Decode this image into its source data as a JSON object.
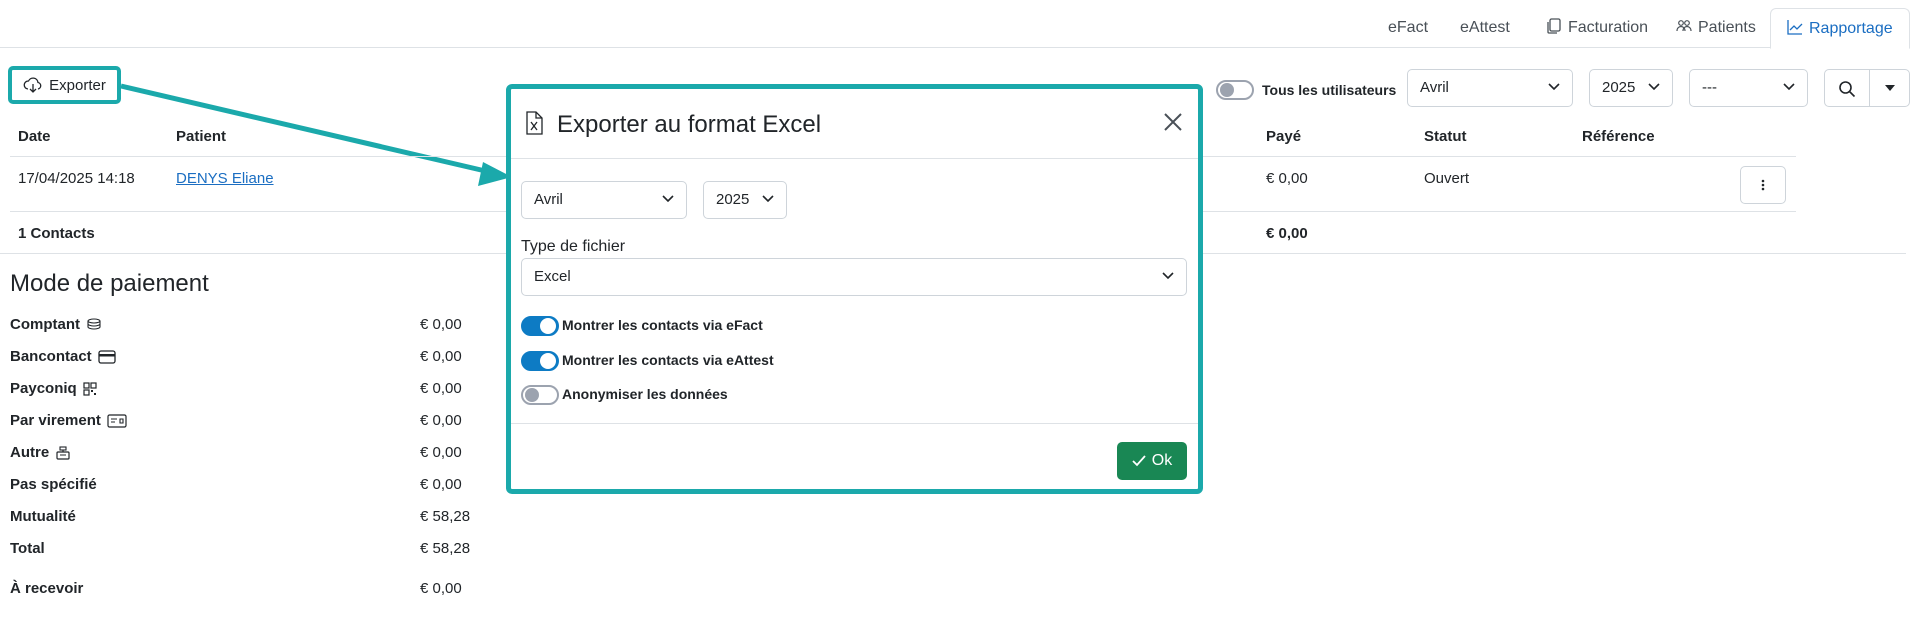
{
  "tabs": [
    {
      "label": "eFact",
      "icon": ""
    },
    {
      "label": "eAttest",
      "icon": ""
    },
    {
      "label": "Facturation",
      "icon": "files-icon"
    },
    {
      "label": "Patients",
      "icon": "people-icon"
    },
    {
      "label": "Rapportage",
      "icon": "graph-up-icon"
    }
  ],
  "toolbar": {
    "export_label": "Exporter",
    "all_users_label": "Tous les utilisateurs",
    "month_value": "Avril",
    "year_value": "2025",
    "extra_value": "---"
  },
  "table": {
    "headers": {
      "date": "Date",
      "patient": "Patient",
      "paid": "Payé",
      "status": "Statut",
      "reference": "Référence"
    },
    "rows": [
      {
        "date": "17/04/2025 14:18",
        "patient": "DENYS Eliane",
        "paid": "€ 0,00",
        "status": "Ouvert",
        "reference": ""
      }
    ],
    "footer": {
      "count": "1 Contacts",
      "paid_total": "€ 0,00"
    }
  },
  "payment": {
    "title": "Mode de paiement",
    "items": [
      {
        "label": "Comptant",
        "value": "€ 0,00",
        "icon": "cash-stack-icon"
      },
      {
        "label": "Bancontact",
        "value": "€ 0,00",
        "icon": "credit-card-icon"
      },
      {
        "label": "Payconiq",
        "value": "€ 0,00",
        "icon": "qr-code-icon"
      },
      {
        "label": "Par virement",
        "value": "€ 0,00",
        "icon": "bank-transfer-icon"
      },
      {
        "label": "Autre",
        "value": "€ 0,00",
        "icon": "cash-register-icon"
      },
      {
        "label": "Pas spécifié",
        "value": "€ 0,00",
        "icon": ""
      },
      {
        "label": "Mutualité",
        "value": "€ 58,28",
        "icon": ""
      },
      {
        "label": "Total",
        "value": "€ 58,28",
        "icon": ""
      },
      {
        "label": "À recevoir",
        "value": "€ 0,00",
        "icon": ""
      }
    ]
  },
  "modal": {
    "title": "Exporter au format Excel",
    "month_value": "Avril",
    "year_value": "2025",
    "file_type_label": "Type de fichier",
    "file_type_value": "Excel",
    "options": [
      {
        "label": "Montrer les contacts via eFact",
        "enabled": true
      },
      {
        "label": "Montrer les contacts via eAttest",
        "enabled": true
      },
      {
        "label": "Anonymiser les données",
        "enabled": false
      }
    ],
    "ok_label": "Ok"
  },
  "colors": {
    "accent": "#1ba9ab",
    "link": "#1b6ec2",
    "toggle_on": "#0d7bc4",
    "ok_button": "#198754"
  }
}
